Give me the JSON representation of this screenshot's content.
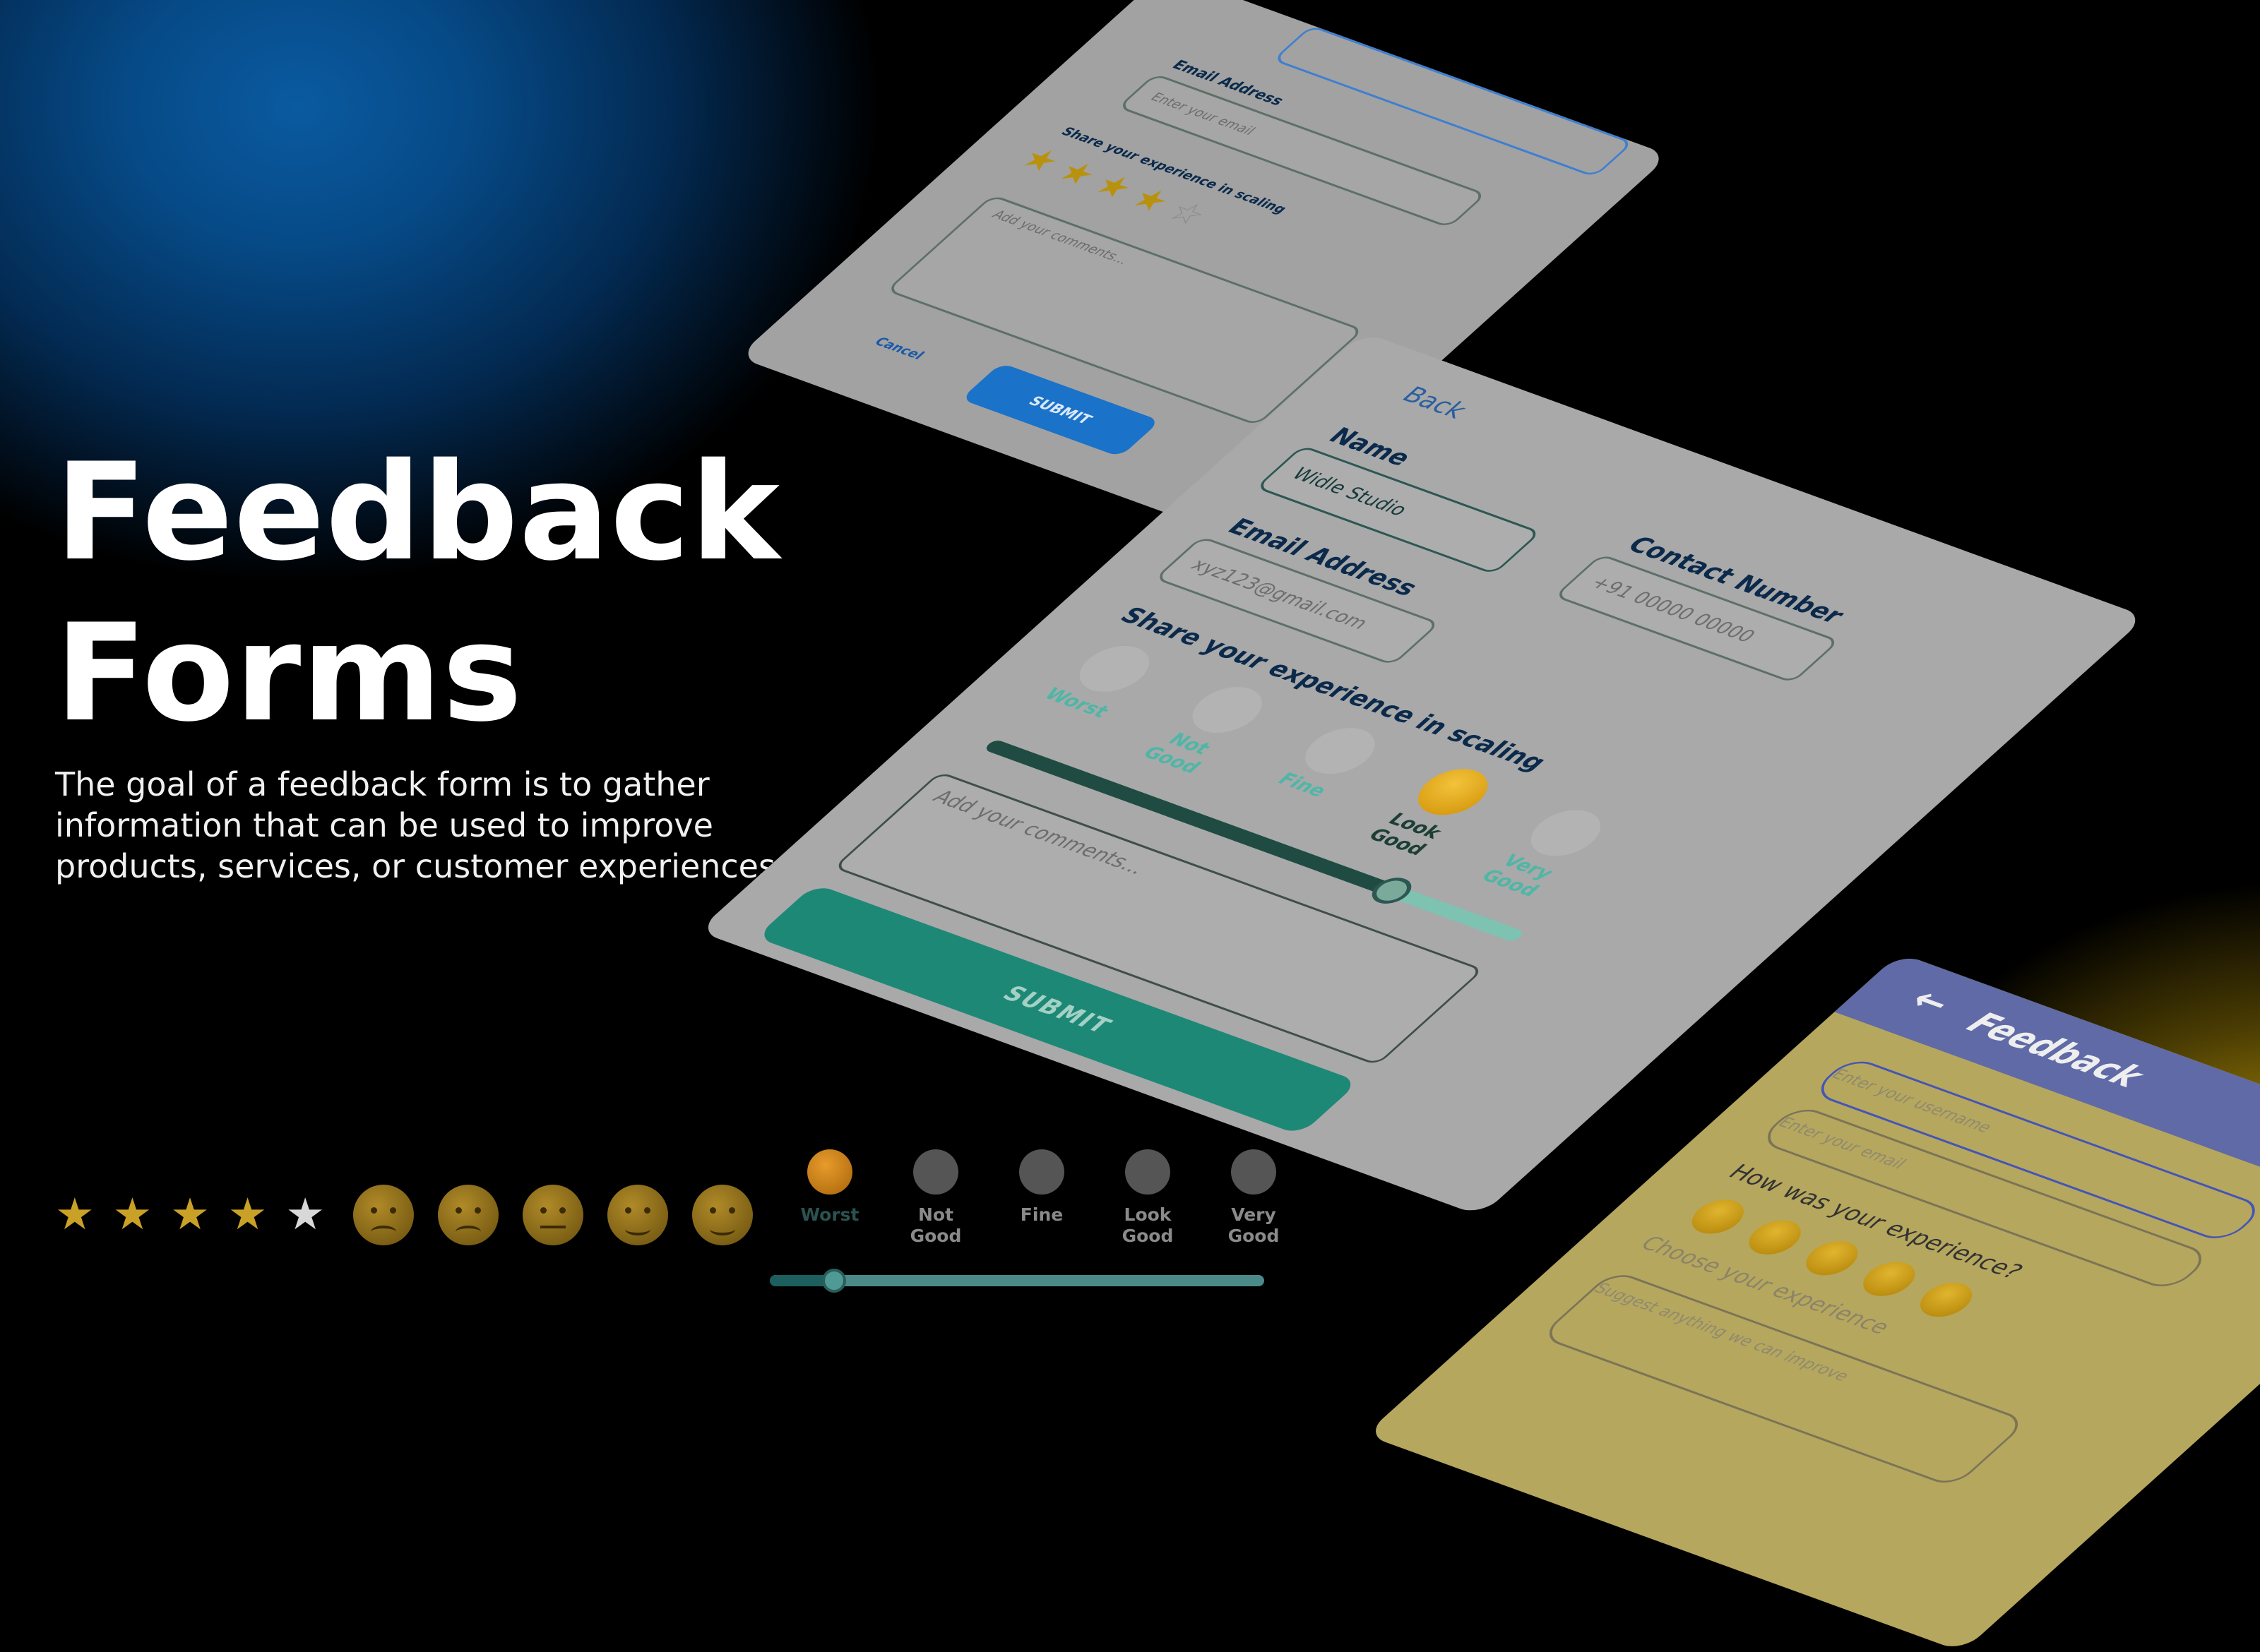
{
  "hero": {
    "title_line1": "Feedback",
    "title_line2": "Forms",
    "description": "The goal of a feedback form is to gather information that can be used to improve products, services, or customer experiences."
  },
  "colors": {
    "blue_glow": "#0a5aa0",
    "yellow_glow": "#d9b30a",
    "teal_submit": "#1e8877",
    "blue_submit": "#1a72c9",
    "header_purple": "#5f6aa6"
  },
  "bottom_widgets": {
    "stars": {
      "filled": 4,
      "total": 5
    },
    "emoji_ratings": [
      "sad-face-icon",
      "frown-face-icon",
      "neutral-face-icon",
      "slight-smile-icon",
      "grin-face-icon"
    ],
    "scale": [
      {
        "label": "Worst",
        "icon": "confounded-face-icon",
        "active": true
      },
      {
        "label": "Not\nGood",
        "icon": "frown-face-icon",
        "active": false
      },
      {
        "label": "Fine",
        "icon": "neutral-face-icon",
        "active": false
      },
      {
        "label": "Look\nGood",
        "icon": "grin-face-icon",
        "active": false
      },
      {
        "label": "Very\nGood",
        "icon": "heart-eyes-icon",
        "active": false
      }
    ],
    "slider_value": 0.13
  },
  "card1": {
    "email_label": "Email Address",
    "email_placeholder": "Enter your email",
    "share_label": "Share your experience in scaling",
    "stars_filled": 4,
    "stars_total": 5,
    "comments_placeholder": "Add your comments...",
    "cancel_label": "Cancel",
    "submit_label": "SUBMIT"
  },
  "card2": {
    "back_label": "Back",
    "name_label": "Name",
    "name_value": "Widle Studio",
    "contact_label": "Contact Number",
    "contact_placeholder": "+91 00000 00000",
    "email_label": "Email Address",
    "email_placeholder": "xyz123@gmail.com",
    "share_label": "Share your experience in scaling",
    "faces": [
      {
        "label": "Worst",
        "icon": "confounded-face-icon",
        "active": false
      },
      {
        "label": "Not Good",
        "icon": "frown-face-icon",
        "active": false
      },
      {
        "label": "Fine",
        "icon": "neutral-face-icon",
        "active": false
      },
      {
        "label": "Look Good",
        "icon": "grin-face-icon",
        "active": true
      },
      {
        "label": "Very Good",
        "icon": "heart-eyes-icon",
        "active": false
      }
    ],
    "slider_value": 0.75,
    "comments_placeholder": "Add your comments...",
    "submit_label": "SUBMIT"
  },
  "card3": {
    "title": "Feedback",
    "username_placeholder": "Enter your username",
    "email_placeholder": "Enter your email",
    "question": "How was your experience?",
    "choose_label": "Choose your experience",
    "suggest_placeholder": "Suggest anything we can improve"
  }
}
